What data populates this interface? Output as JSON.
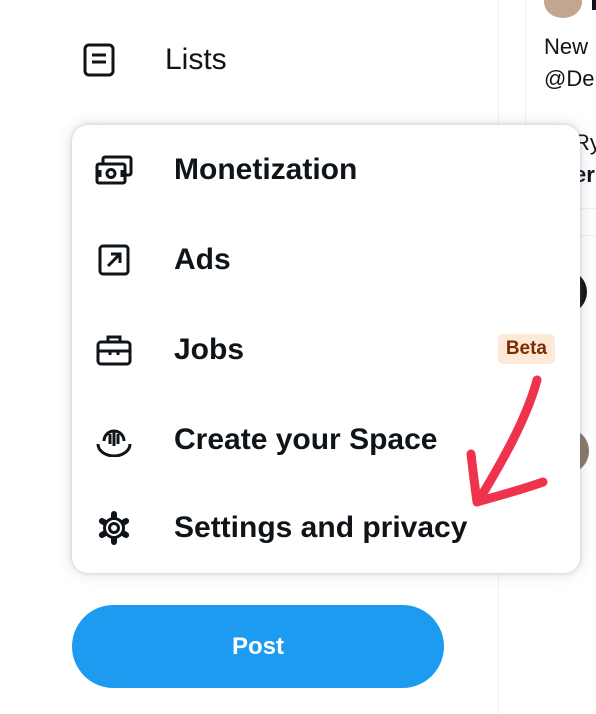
{
  "nav": {
    "lists_label": "Lists",
    "lists_icon": "lists-icon"
  },
  "menu": {
    "items": [
      {
        "label": "Monetization",
        "icon": "monetization-icon"
      },
      {
        "label": "Ads",
        "icon": "ads-icon"
      },
      {
        "label": "Jobs",
        "icon": "briefcase-icon",
        "badge": "Beta"
      },
      {
        "label": "Create your Space",
        "icon": "spaces-icon"
      },
      {
        "label": "Settings and privacy",
        "icon": "gear-icon"
      }
    ]
  },
  "post_button": {
    "label": "Post"
  },
  "right_panel": {
    "line1": "New",
    "line2": "@De",
    "line3": "Ry",
    "line4": "er"
  },
  "annotation": {
    "arrow_color": "#f0334d"
  },
  "colors": {
    "accent": "#1d9bf0",
    "text": "#0f1419",
    "badge_bg": "#fde9d6",
    "badge_text": "#7a2d04"
  }
}
